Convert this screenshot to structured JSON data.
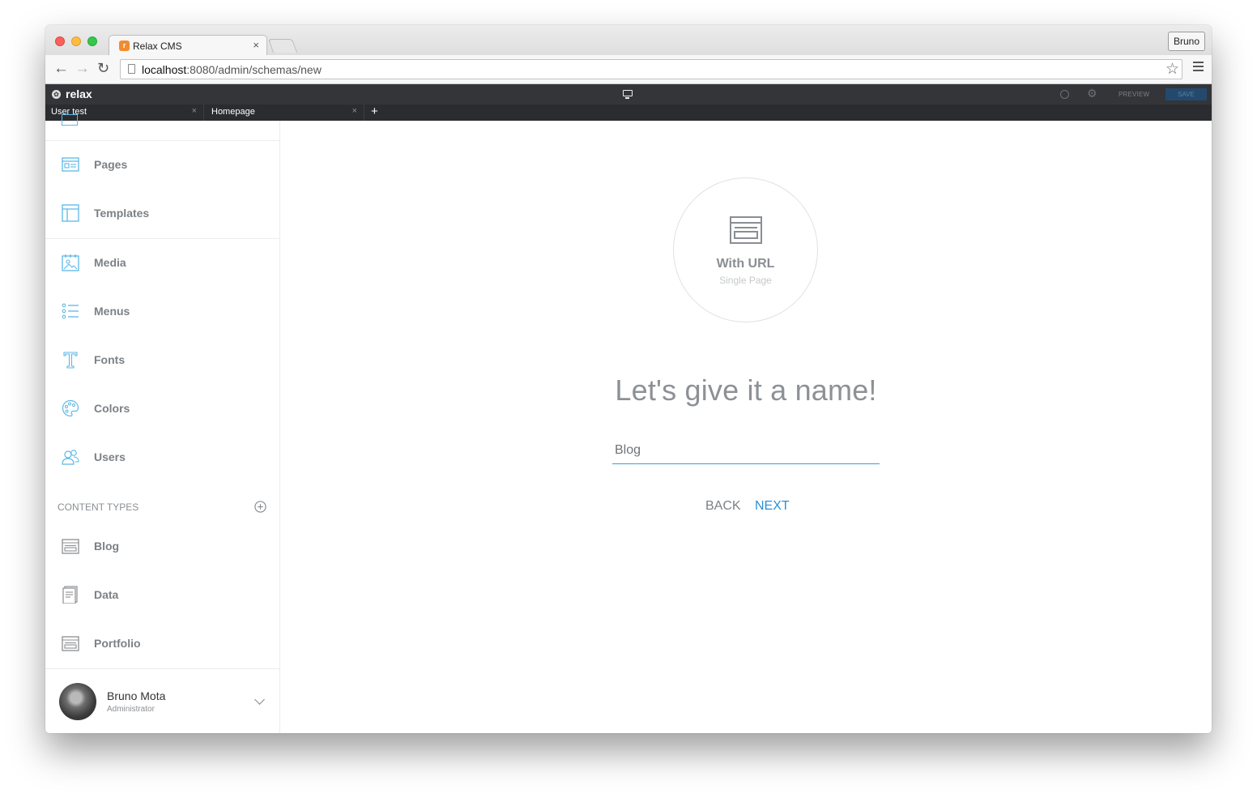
{
  "browser": {
    "tab_title": "Relax CMS",
    "favicon_letter": "r",
    "profile_name": "Bruno",
    "url_host": "localhost",
    "url_path": ":8080/admin/schemas/new"
  },
  "app": {
    "logo": "relax",
    "preview_label": "PREVIEW",
    "save_label": "SAVE",
    "page_tabs": [
      {
        "label": "User test"
      },
      {
        "label": "Homepage"
      }
    ],
    "add_tab": "+"
  },
  "sidebar": {
    "items": [
      {
        "label": "Pages",
        "icon": "pages-icon"
      },
      {
        "label": "Templates",
        "icon": "templates-icon"
      },
      {
        "label": "Media",
        "icon": "media-icon"
      },
      {
        "label": "Menus",
        "icon": "menus-icon"
      },
      {
        "label": "Fonts",
        "icon": "fonts-icon"
      },
      {
        "label": "Colors",
        "icon": "colors-icon"
      },
      {
        "label": "Users",
        "icon": "users-icon"
      }
    ],
    "content_types_heading": "CONTENT TYPES",
    "content_types": [
      {
        "label": "Blog",
        "icon": "blog-icon"
      },
      {
        "label": "Data",
        "icon": "data-icon"
      },
      {
        "label": "Portfolio",
        "icon": "portfolio-icon"
      }
    ],
    "user": {
      "name": "Bruno Mota",
      "role": "Administrator"
    }
  },
  "main": {
    "type_title": "With URL",
    "type_subtitle": "Single Page",
    "heading": "Let's give it a name!",
    "name_value": "Blog",
    "back_label": "BACK",
    "next_label": "NEXT"
  },
  "colors": {
    "accent": "#2c8fd6",
    "sidebar_icon": "#5cb8e6",
    "appbar": "#333539"
  }
}
